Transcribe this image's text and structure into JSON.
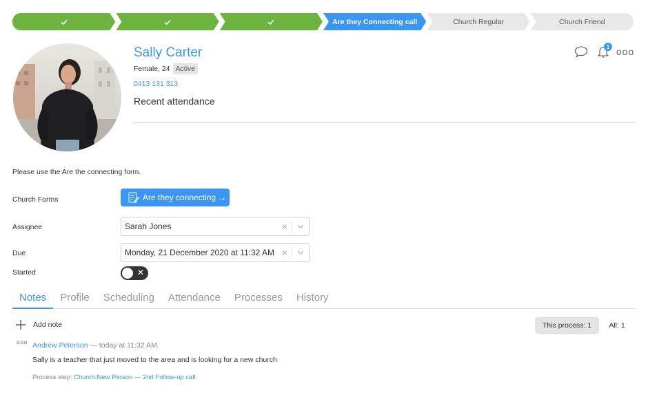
{
  "steps": [
    {
      "label": "",
      "state": "done"
    },
    {
      "label": "",
      "state": "done"
    },
    {
      "label": "",
      "state": "done"
    },
    {
      "label": "Are they Connecting call",
      "state": "current"
    },
    {
      "label": "Church Regular",
      "state": "pending"
    },
    {
      "label": "Church Friend",
      "state": "pending"
    }
  ],
  "profile": {
    "name": "Sally Carter",
    "gender_age": "Female, 24",
    "status": "Active",
    "phone": "0413 131 313",
    "recent_attendance": "Recent attendance"
  },
  "header_actions": {
    "notification_count": "1",
    "more_label": "ooo"
  },
  "form": {
    "instruction": "Please use the Are the connecting form.",
    "church_forms_label": "Church Forms",
    "form_button_label": "Are they connecting →",
    "assignee_label": "Assignee",
    "assignee_value": "Sarah Jones",
    "due_label": "Due",
    "due_value": "Monday, 21 December 2020 at 11:32 AM",
    "started_label": "Started",
    "started_on": false
  },
  "tabs": [
    "Notes",
    "Profile",
    "Scheduling",
    "Attendance",
    "Processes",
    "History"
  ],
  "notes": {
    "add_note_label": "Add note",
    "filter_this_process": "This process: 1",
    "filter_all": "All: 1",
    "items": [
      {
        "author": "Andrew Peterson",
        "time": "— today at 11:32 AM",
        "text": "Sally is a teacher that just moved to the area and is looking for a new church",
        "step_prefix": "Process step: ",
        "step_link": "Church:New Person — 2nd Follow-up call"
      }
    ]
  },
  "colors": {
    "accent": "#3a96f2",
    "done": "#6cb33f"
  }
}
